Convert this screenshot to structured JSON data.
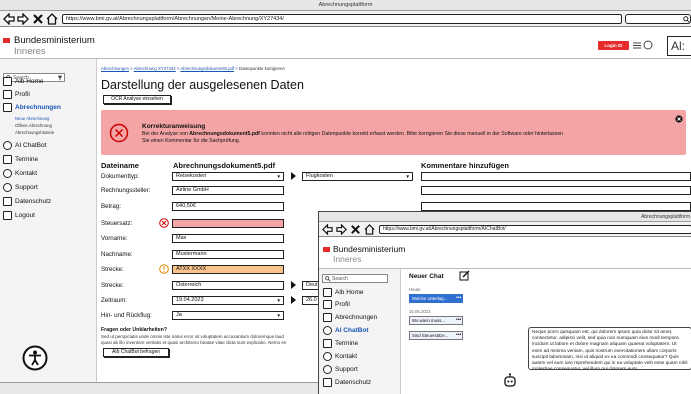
{
  "browser": {
    "title": "Abrechnungsplattform",
    "url": "https://www.bmi.gv.at/Abrechnungsplattform/Abrechnungen/Meine-Abrechnung/XY27434/"
  },
  "header": {
    "brand_line1": "Bundesministerium",
    "brand_line2": "Inneres",
    "login_label": "Login ID Austria",
    "lang_badge": "Al:"
  },
  "sidebar": {
    "search_placeholder": "Search",
    "items": [
      {
        "label": "Alb Home",
        "icon": "home-icon"
      },
      {
        "label": "Profil",
        "icon": "profile-icon"
      },
      {
        "label": "Abrechnungen",
        "icon": "documents-icon"
      }
    ],
    "subitems": [
      "Neue Abrechnung",
      "Offene Abrechnung",
      "Abrechnungshistorie"
    ],
    "items2": [
      {
        "label": "AI ChatBot",
        "icon": "chatbot-icon"
      },
      {
        "label": "Termine",
        "icon": "calendar-icon"
      },
      {
        "label": "Kontakt",
        "icon": "chat-bubble-icon"
      },
      {
        "label": "Support",
        "icon": "info-icon"
      },
      {
        "label": "Datenschutz",
        "icon": "lock-icon"
      },
      {
        "label": "Logout",
        "icon": "logout-icon"
      }
    ]
  },
  "breadcrumb": [
    "Abrechnungen",
    "Abrechnung XY27434",
    "Abrechnungsdokument5.pdf"
  ],
  "breadcrumb_current": "Datenpunkte korrigieren",
  "page_title": "Darstellung der ausgelesenen Daten",
  "ocr_button": "OCR Analyse einsehen",
  "alert": {
    "title": "Korrekturanweisung",
    "text_a": "Bei der Analyse von ",
    "text_file": "Abrechnungsdokument5.pdf",
    "text_b": " konnten nicht alle nötigen Datenpunkte korrekt erfasst werden. Bitte korrigieren Sie diese manuell in der Software oder hinterlassen",
    "text_c": "Sie einen Kommentar für die Sachprüfung."
  },
  "form": {
    "col_label": "Dateiname",
    "filename": "Abrechnungsdokument5.pdf",
    "comments_title": "Kommentare hinzufügen",
    "fields": [
      {
        "label": "Dokumenttyp:",
        "value": "Reisekosten",
        "state": "select"
      },
      {
        "label": "Rechnungssteller:",
        "value": "Airline GmbH",
        "state": "ok"
      },
      {
        "label": "Betrag:",
        "value": "640,50€",
        "state": "ok"
      },
      {
        "label": "Steuersatz:",
        "value": "",
        "state": "error"
      },
      {
        "label": "Vorname:",
        "value": "Max",
        "state": "ok"
      },
      {
        "label": "Nachname:",
        "value": "Mustermann",
        "state": "ok"
      },
      {
        "label": "Strecke:",
        "value": "ATXX XXXX",
        "state": "warning"
      },
      {
        "label": "Strecke:",
        "value": "Österreich",
        "state": "ok"
      },
      {
        "label": "Zeitraum:",
        "value": "19.04.2023",
        "state": "select"
      },
      {
        "label": "Hin- und Rückflug:",
        "value": "Ja",
        "state": "select"
      }
    ],
    "subselect": "Flugkosten",
    "strecke_right": "Deut",
    "zeitraum_right": "26.0"
  },
  "help": {
    "title": "Fragen oder Unklarheiten?",
    "text1": "Sed ut perspiciatis unde omnis iste natus error sit voluptatem accusantium doloremque laud",
    "text2": "quasi ab illo inventore veritatis et quasi architecto beatae vitae dicta sunt explicabo. Nemo en",
    "button": "AIb ChatBot befragen"
  },
  "browser2": {
    "title": "Abrechnungsplattform",
    "url": "https://www.bmi.gv.at/Abrechnungsplattform/AIChatBot/",
    "search": "Search",
    "nav": [
      "Alb Home",
      "Profil",
      "Abrechnungen",
      "AI ChatBot",
      "Termine",
      "Kontakt",
      "Support",
      "Datenschutz"
    ],
    "new_chat": "Neuer Chat",
    "today": "Heute",
    "chats": [
      "Welche Unterlag...",
      "Wo wann muss...",
      "Sind Steuersätze..."
    ],
    "date": "15.05.2023",
    "bubble_text": "Neque porro quisquam est, qui dolorem ipsum quia dolor sit amet, consectetur, adipisci velit, sed quia non numquam eius modi tempora incidunt ut labore et dolore magnam aliquam quaerat voluptatem. Ut enim ad minima veniam, quis nostrum exercitationem ullam corporis suscipit laboriosam, nisi ut aliquid ex ea commodi consequatur? Quis autem vel eum iure reprehenderit qui in ea voluptate velit esse quam nihil molestiae consequatur, vel illum qui dolorem eum"
  },
  "colors": {
    "accent": "#e52b2b",
    "link": "#1a57b4",
    "error": "#f4a4a4",
    "warning": "#f9c38a",
    "active_chat": "#2f6fcf"
  }
}
